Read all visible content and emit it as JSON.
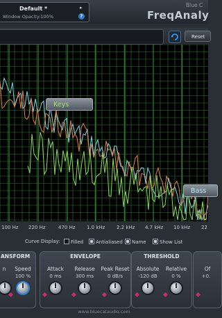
{
  "preset": {
    "name": "Default *",
    "window_opacity": "Window Opacity:100%",
    "play_glyph": "▸",
    "help_glyph": "?"
  },
  "brand": {
    "line1": "Blue C",
    "line2": "FreqAnaly"
  },
  "toolbar": {
    "reset_label": "Reset"
  },
  "graph": {
    "colors": {
      "keys": "#8ed85c",
      "bass": "#7fd3ea",
      "other": "#e0804a",
      "grid": "#2f7a2f",
      "grid_major": "#3d9a3d"
    },
    "labels": {
      "keys": "Keys",
      "bass": "Bass"
    },
    "freq_ticks": [
      "100 Hz",
      "220 Hz",
      "470 Hz",
      "1.0 kHz",
      "2.2 kHz",
      "4.7 kHz",
      "10 kHz",
      "22"
    ]
  },
  "curve_display": {
    "label": "Curve Display:",
    "filled": "Filled",
    "antialiased": "Antialiased",
    "name": "Name",
    "show_list": "Show List",
    "filled_checked": false,
    "antialiased_checked": true,
    "name_checked": true,
    "show_list_checked": true
  },
  "panels": {
    "transform": {
      "title": "ANSFORM",
      "controls": [
        {
          "label": "n",
          "value": ""
        },
        {
          "label": "Speed",
          "value": "100 %"
        }
      ]
    },
    "envelope": {
      "title": "ENVELOPE",
      "controls": [
        {
          "label": "Attack",
          "value": "0 ms"
        },
        {
          "label": "Release",
          "value": "300 ms"
        },
        {
          "label": "Peak Reset",
          "value": "0 dB/s"
        }
      ]
    },
    "threshold": {
      "title": "THRESHOLD",
      "controls": [
        {
          "label": "Absolute",
          "value": "-120 dB"
        },
        {
          "label": "Relative",
          "value": "0 %"
        }
      ]
    },
    "offset": {
      "title": "",
      "controls": [
        {
          "label": "Of",
          "value": "+0."
        }
      ]
    }
  },
  "footer": {
    "url": "www.bluecataudio.com"
  }
}
